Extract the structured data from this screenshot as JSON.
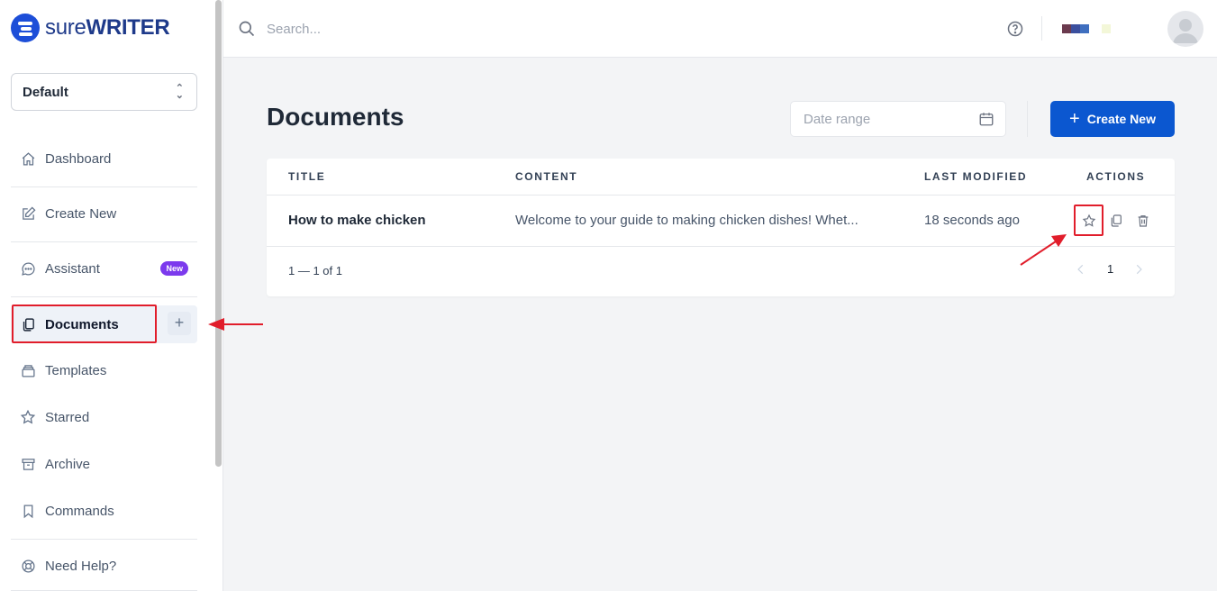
{
  "brand": {
    "name_light": "sure",
    "name_bold": "WRITER",
    "mark_color": "#1d4ed8"
  },
  "workspace": {
    "selected": "Default"
  },
  "sidebar": {
    "items": [
      {
        "label": "Dashboard",
        "icon": "home-icon"
      },
      {
        "label": "Create New",
        "icon": "edit-icon"
      },
      {
        "label": "Assistant",
        "icon": "chat-icon",
        "badge": "New"
      },
      {
        "label": "Documents",
        "icon": "documents-icon",
        "active": true
      },
      {
        "label": "Templates",
        "icon": "templates-icon"
      },
      {
        "label": "Starred",
        "icon": "star-icon"
      },
      {
        "label": "Archive",
        "icon": "archive-icon"
      },
      {
        "label": "Commands",
        "icon": "bookmark-icon"
      },
      {
        "label": "Need Help?",
        "icon": "lifebuoy-icon"
      }
    ]
  },
  "search": {
    "placeholder": "Search..."
  },
  "page": {
    "title": "Documents",
    "date_range_placeholder": "Date range",
    "create_label": "Create New"
  },
  "table": {
    "headers": {
      "title": "TITLE",
      "content": "CONTENT",
      "modified": "LAST MODIFIED",
      "actions": "ACTIONS"
    },
    "rows": [
      {
        "title": "How to make chicken",
        "content": "Welcome to your guide to making chicken dishes! Whet...",
        "modified": "18 seconds ago",
        "actions": [
          "star-icon",
          "copy-icon",
          "trash-icon"
        ]
      }
    ],
    "range_text": "1 — 1 of 1",
    "current_page": "1"
  },
  "colors": {
    "accent": "#0b57d0",
    "highlight": "#e11d2b",
    "badge": "#7c3aed",
    "swatches": [
      "#6b3a4e",
      "#3b4f9e",
      "#3f6fbf",
      "#f3f7d8"
    ]
  }
}
